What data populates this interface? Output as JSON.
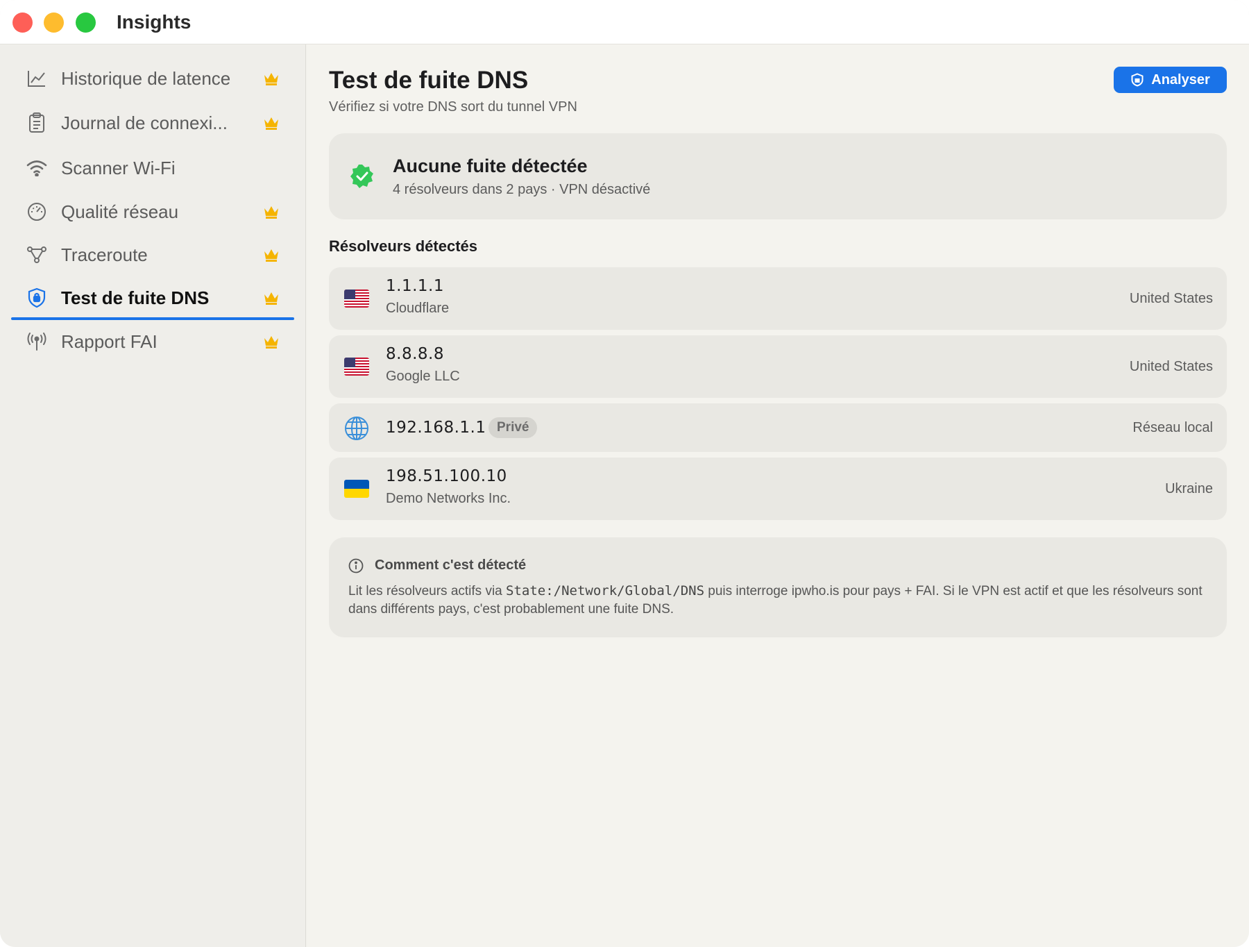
{
  "window": {
    "title": "Insights"
  },
  "sidebar": {
    "items": [
      {
        "label": "Historique de latence",
        "icon": "line-chart-icon",
        "premium": true
      },
      {
        "label": "Journal de connexi...",
        "icon": "clipboard-icon",
        "premium": true
      },
      {
        "label": "Scanner Wi-Fi",
        "icon": "wifi-icon",
        "premium": false
      },
      {
        "label": "Qualité réseau",
        "icon": "gauge-icon",
        "premium": true
      },
      {
        "label": "Traceroute",
        "icon": "nodes-icon",
        "premium": true
      },
      {
        "label": "Test de fuite DNS",
        "icon": "shield-lock-icon",
        "premium": true,
        "active": true
      },
      {
        "label": "Rapport FAI",
        "icon": "antenna-icon",
        "premium": true
      }
    ]
  },
  "main": {
    "title": "Test de fuite DNS",
    "subtitle": "Vérifiez si votre DNS sort du tunnel VPN",
    "analyze_label": "Analyser",
    "status": {
      "title": "Aucune fuite détectée",
      "subtitle": "4 résolveurs dans 2 pays · VPN désactivé",
      "color": "#34c759"
    },
    "resolvers_title": "Résolveurs détectés",
    "resolvers": [
      {
        "ip": "1.1.1.1",
        "org": "Cloudflare",
        "country": "United States",
        "flag": "us-flag-icon"
      },
      {
        "ip": "8.8.8.8",
        "org": "Google LLC",
        "country": "United States",
        "flag": "us-flag-icon"
      },
      {
        "ip": "192.168.1.1",
        "badge": "Privé",
        "country": "Réseau local",
        "flag": "globe-icon"
      },
      {
        "ip": "198.51.100.10",
        "org": "Demo Networks Inc.",
        "country": "Ukraine",
        "flag": "ua-flag-icon"
      }
    ],
    "info": {
      "title": "Comment c'est détecté",
      "text_before": "Lit les résolveurs actifs via ",
      "code": "State:/Network/Global/DNS",
      "text_after": " puis interroge ipwho.is pour pays + FAI. Si le VPN est actif et que les résolveurs sont dans différents pays, c'est probablement une fuite DNS."
    }
  },
  "colors": {
    "accent": "#1a73e8",
    "crown": "#f5b400"
  }
}
